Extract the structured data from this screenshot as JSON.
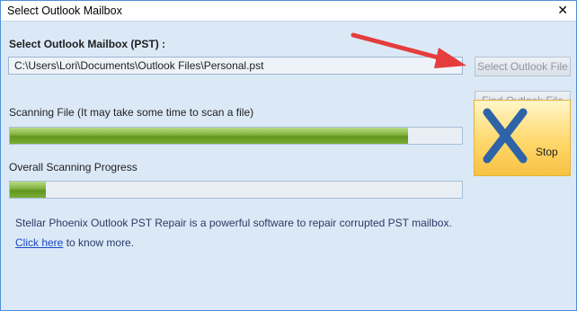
{
  "window": {
    "title": "Select Outlook Mailbox",
    "close_glyph": "✕"
  },
  "mailbox": {
    "label": "Select Outlook Mailbox (PST) :",
    "path_value": "C:\\Users\\Lori\\Documents\\Outlook Files\\Personal.pst"
  },
  "buttons": {
    "select_label": "Select Outlook File",
    "find_label": "Find Outlook File",
    "stop_label": "Stop",
    "stop_icon": "x-icon"
  },
  "progress": {
    "scan_label": "Scanning File (It may take some time to scan a file)",
    "scan_fraction": 0.88,
    "overall_label": "Overall Scanning Progress",
    "overall_fraction": 0.08
  },
  "info": {
    "description": "Stellar Phoenix Outlook PST Repair is a powerful software to repair corrupted PST mailbox.",
    "link_text": "Click here",
    "after_link": "to know more."
  },
  "colors": {
    "window_bg": "#dbe9f7",
    "progress_green": "#6ea52a",
    "stop_bg": "#ffd86b",
    "stop_x": "#2e63a8",
    "arrow": "#e53d3d"
  }
}
